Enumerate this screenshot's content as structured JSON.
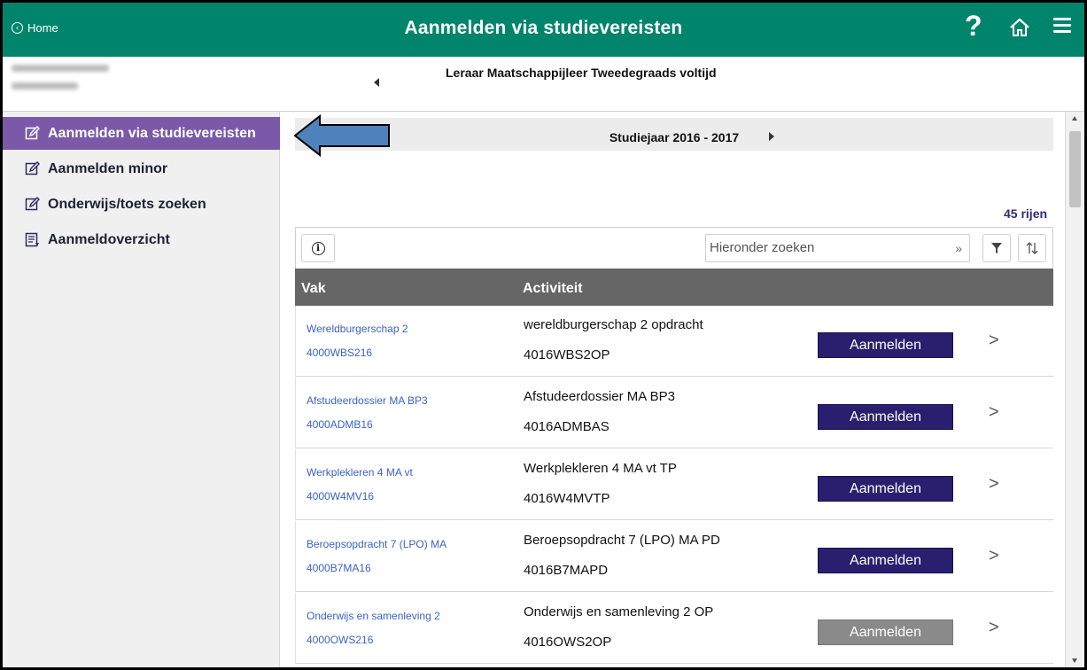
{
  "header": {
    "home_label": "Home",
    "title": "Aanmelden via studievereisten",
    "help_label": "?",
    "color": "#00856c"
  },
  "program": {
    "title": "Leraar Maatschappijleer Tweedegraads voltijd"
  },
  "sidebar": {
    "items": [
      {
        "label": "Aanmelden via studievereisten",
        "icon": "edit-icon",
        "active": true
      },
      {
        "label": "Aanmelden minor",
        "icon": "edit-icon",
        "active": false
      },
      {
        "label": "Onderwijs/toets zoeken",
        "icon": "edit-icon",
        "active": false
      },
      {
        "label": "Aanmeldoverzicht",
        "icon": "list-icon",
        "active": false
      }
    ],
    "active_color": "#7a5aa8"
  },
  "year": {
    "label": "Studiejaar 2016 - 2017"
  },
  "table": {
    "row_count": "45 rijen",
    "search_placeholder": "Hieronder zoeken",
    "search_go": "»",
    "columns": [
      "Vak",
      "Activiteit"
    ],
    "rows": [
      {
        "course": "Wereldburgerschap 2",
        "course_code": "4000WBS216",
        "activity": "wereldburgerschap 2 opdracht",
        "activity_code": "4016WBS2OP",
        "button": "Aanmelden",
        "enabled": true
      },
      {
        "course": "Afstudeerdossier MA BP3",
        "course_code": "4000ADMB16",
        "activity": "Afstudeerdossier MA BP3",
        "activity_code": "4016ADMBAS",
        "button": "Aanmelden",
        "enabled": true
      },
      {
        "course": "Werkplekleren 4 MA vt",
        "course_code": "4000W4MV16",
        "activity": "Werkplekleren 4 MA vt TP",
        "activity_code": "4016W4MVTP",
        "button": "Aanmelden",
        "enabled": true
      },
      {
        "course": "Beroepsopdracht 7 (LPO) MA",
        "course_code": "4000B7MA16",
        "activity": "Beroepsopdracht 7 (LPO) MA PD",
        "activity_code": "4016B7MAPD",
        "button": "Aanmelden",
        "enabled": true
      },
      {
        "course": "Onderwijs en samenleving 2",
        "course_code": "4000OWS216",
        "activity": "Onderwijs en samenleving 2 OP",
        "activity_code": "4016OWS2OP",
        "button": "Aanmelden",
        "enabled": false
      }
    ],
    "button_color": "#2a1e6e",
    "header_color": "#666666"
  }
}
